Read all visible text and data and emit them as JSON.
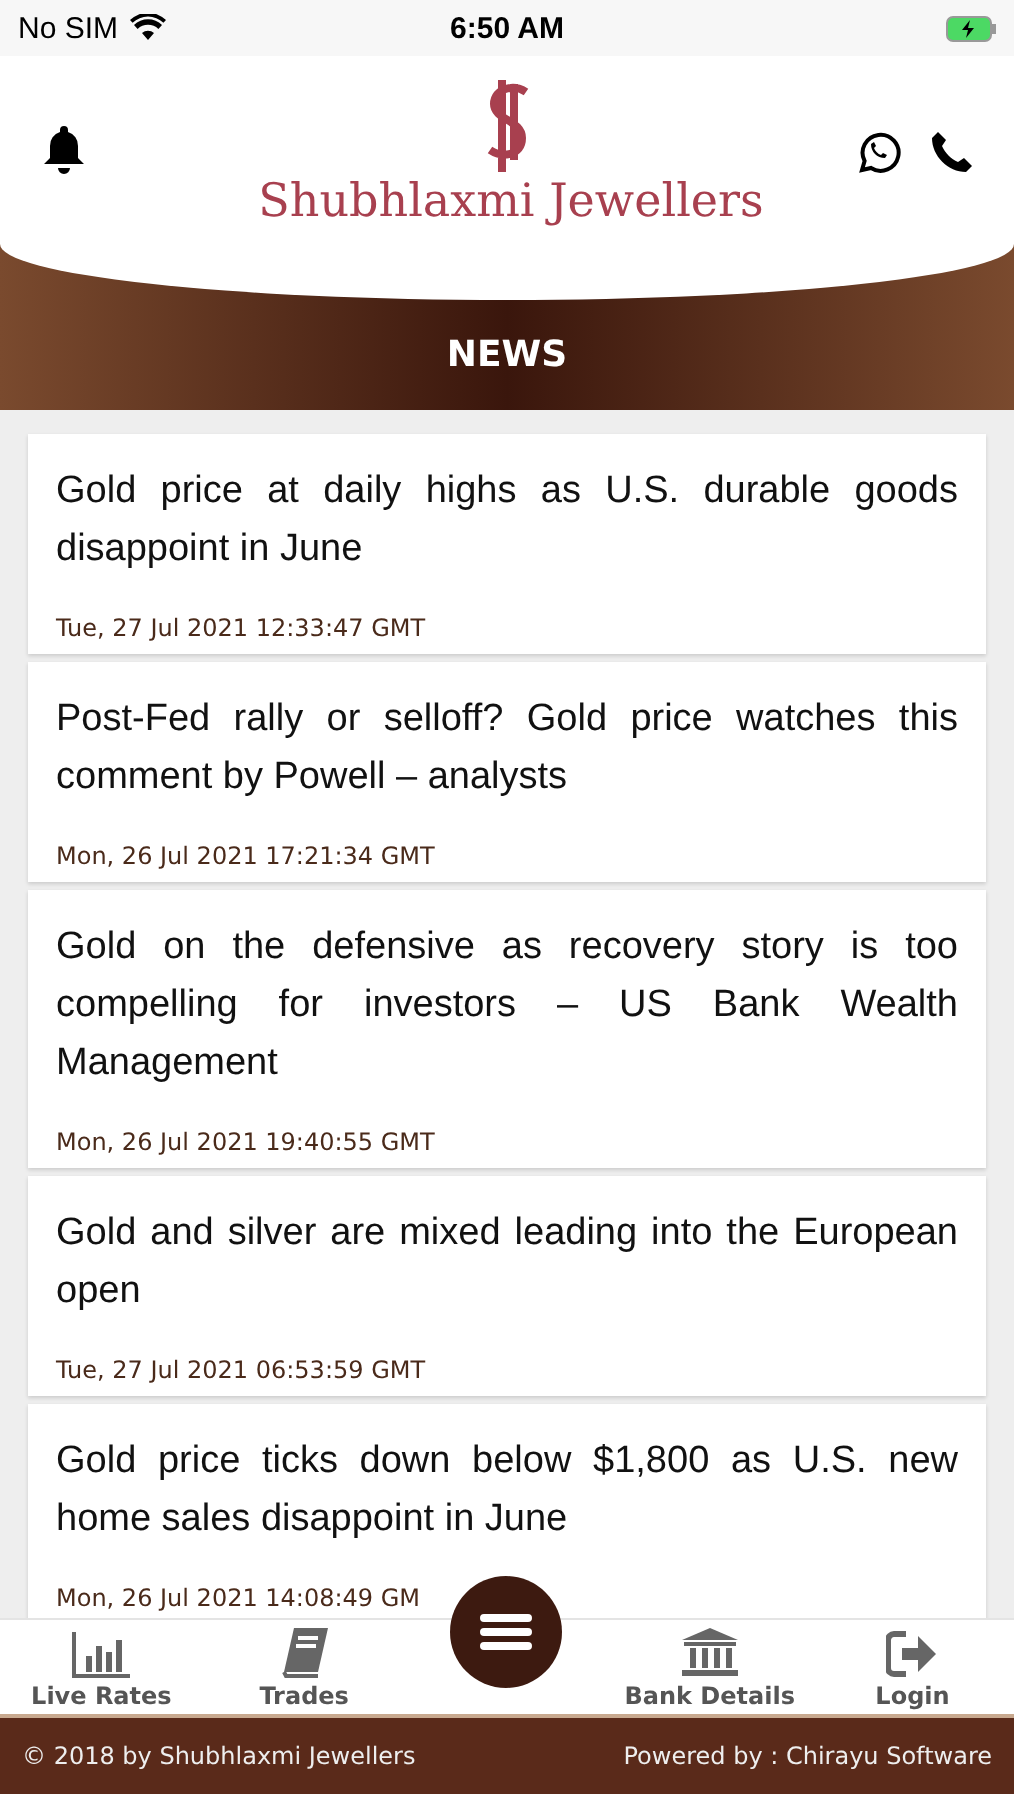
{
  "status_bar": {
    "carrier": "No SIM",
    "time": "6:50 AM"
  },
  "header": {
    "brand": "Shubhlaxmi Jewellers",
    "title": "NEWS"
  },
  "news": [
    {
      "headline": "Gold price at daily highs as U.S. durable goods disappoint in June",
      "date": "Tue, 27 Jul 2021 12:33:47 GMT"
    },
    {
      "headline": "Post-Fed rally or selloff? Gold price watches this comment by Powell – analysts",
      "date": "Mon, 26 Jul 2021 17:21:34 GMT"
    },
    {
      "headline": "Gold on the defensive as recovery story is too compelling for investors – US Bank Wealth Management",
      "date": "Mon, 26 Jul 2021 19:40:55 GMT"
    },
    {
      "headline": "Gold and silver are mixed leading into the European open",
      "date": "Tue, 27 Jul 2021 06:53:59 GMT"
    },
    {
      "headline": "Gold price ticks down below $1,800 as U.S. new home sales disappoint in June",
      "date": "Mon, 26 Jul 2021 14:08:49 GM"
    }
  ],
  "nav": [
    {
      "kind": "chart",
      "label": "Live Rates"
    },
    {
      "kind": "book",
      "label": "Trades"
    },
    {
      "kind": "menu"
    },
    {
      "kind": "bank",
      "label": "Bank Details"
    },
    {
      "kind": "login",
      "label": "Login"
    }
  ],
  "footer": {
    "copyright": "© 2018 by Shubhlaxmi Jewellers",
    "powered": "Powered by : Chirayu Software"
  }
}
